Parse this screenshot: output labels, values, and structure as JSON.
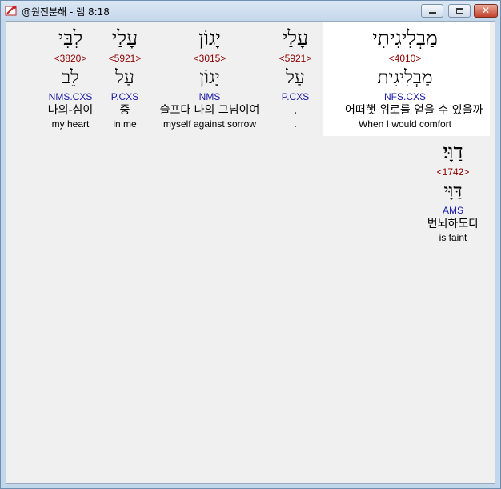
{
  "window": {
    "title": "@원전분해 - 렘 8:18",
    "minimize_icon": "minimize-icon",
    "maximize_icon": "maximize-icon",
    "close_icon": "close-icon",
    "close_glyph": "✕"
  },
  "words": [
    {
      "hebrew": "מַבְלִיגִיתִי",
      "strong": "<4010>",
      "root": "מַבְלִיגִית",
      "morph": "NFS.CXS",
      "korean": "어떠햇 위로를 얻을 수 있을까",
      "english": "When I would comfort",
      "highlighted": true
    },
    {
      "hebrew": "עָלַי",
      "strong": "<5921>",
      "root": "עַל",
      "morph": "P.CXS",
      "korean": ".",
      "english": "."
    },
    {
      "hebrew": "יָגוֹן",
      "strong": "<3015>",
      "root": "יָגוֹן",
      "morph": "NMS",
      "korean": "슬프다 나의 그님이여",
      "english": "myself against sorrow"
    },
    {
      "hebrew": "עָלַי",
      "strong": "<5921>",
      "root": "עַל",
      "morph": "P.CXS",
      "korean": "중",
      "english": "in me"
    },
    {
      "hebrew": "לִבִּי",
      "strong": "<3820>",
      "root": "לֵב",
      "morph": "NMS.CXS",
      "korean": "나의-심이",
      "english": "my heart"
    },
    {
      "hebrew": "דַוָּי׃",
      "strong": "<1742>",
      "root": "דַּוָּי",
      "morph": "AMS",
      "korean": "번뇌하도다",
      "english": "is faint"
    }
  ]
}
